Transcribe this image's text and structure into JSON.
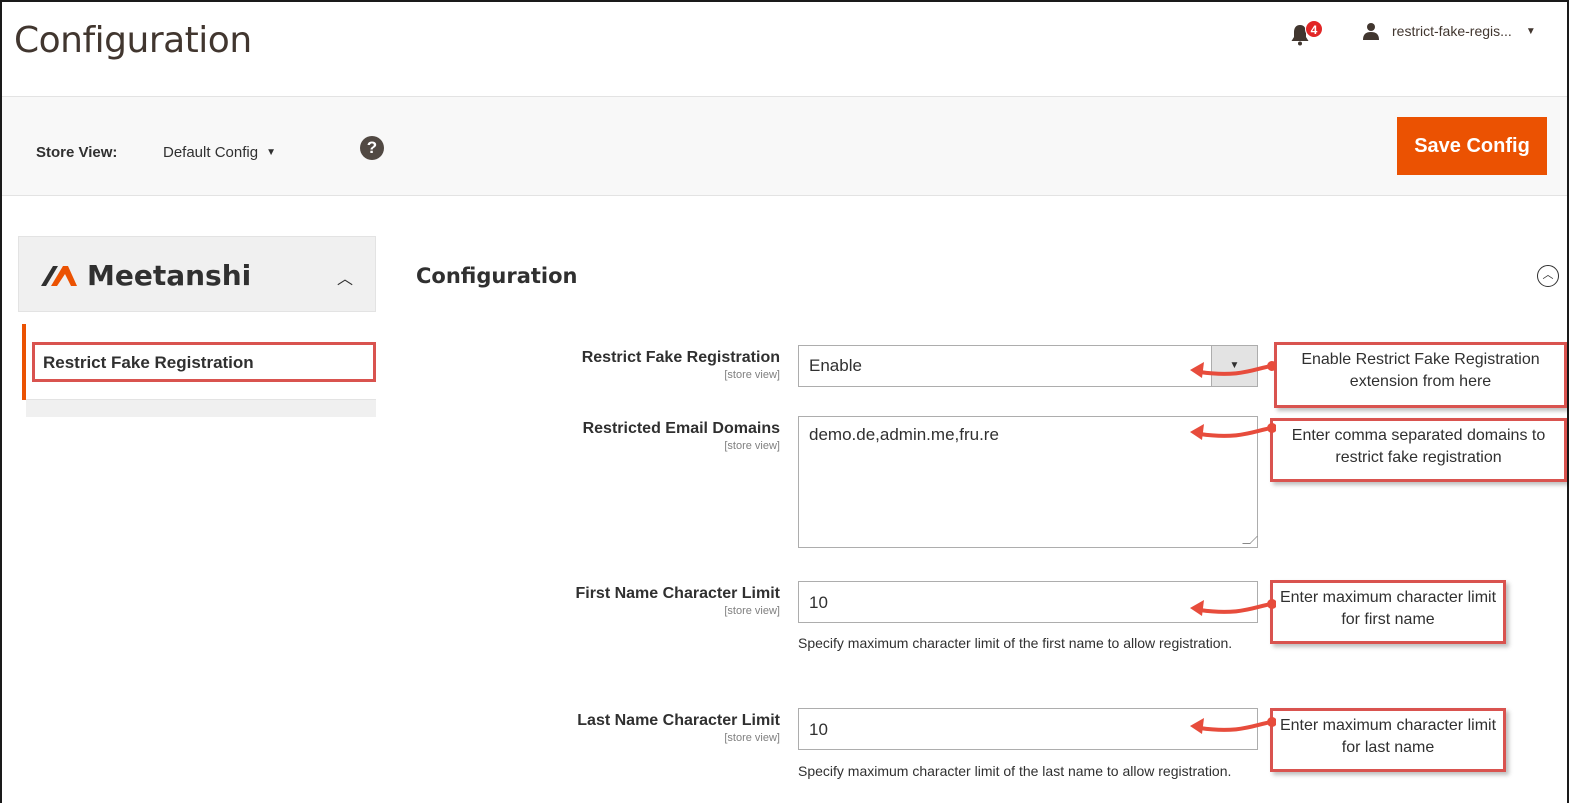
{
  "header": {
    "title": "Configuration",
    "notification_count": "4",
    "username": "restrict-fake-regis..."
  },
  "toolbar": {
    "store_view_label": "Store View:",
    "store_view_value": "Default Config",
    "help_label": "?",
    "save_label": "Save Config"
  },
  "sidebar": {
    "brand": "Meetanshi",
    "items": [
      {
        "label": "Restrict Fake Registration"
      }
    ]
  },
  "section": {
    "title": "Configuration"
  },
  "fields": {
    "enable": {
      "label": "Restrict Fake Registration",
      "scope": "[store view]",
      "value": "Enable"
    },
    "domains": {
      "label": "Restricted Email Domains",
      "scope": "[store view]",
      "value": "demo.de,admin.me,fru.re"
    },
    "first_name": {
      "label": "First Name Character Limit",
      "scope": "[store view]",
      "value": "10",
      "note": "Specify maximum character limit of the first name to allow registration."
    },
    "last_name": {
      "label": "Last Name Character Limit",
      "scope": "[store view]",
      "value": "10",
      "note": "Specify maximum character limit of the last name to allow registration."
    }
  },
  "callouts": {
    "enable": "Enable Restrict Fake Registration extension from here",
    "domains": "Enter comma separated domains to restrict fake registration",
    "first_name": "Enter maximum character limit for first name",
    "last_name": "Enter maximum character limit for last name"
  },
  "colors": {
    "accent": "#eb5202",
    "annotation": "#d9534f",
    "badge": "#e22626"
  }
}
